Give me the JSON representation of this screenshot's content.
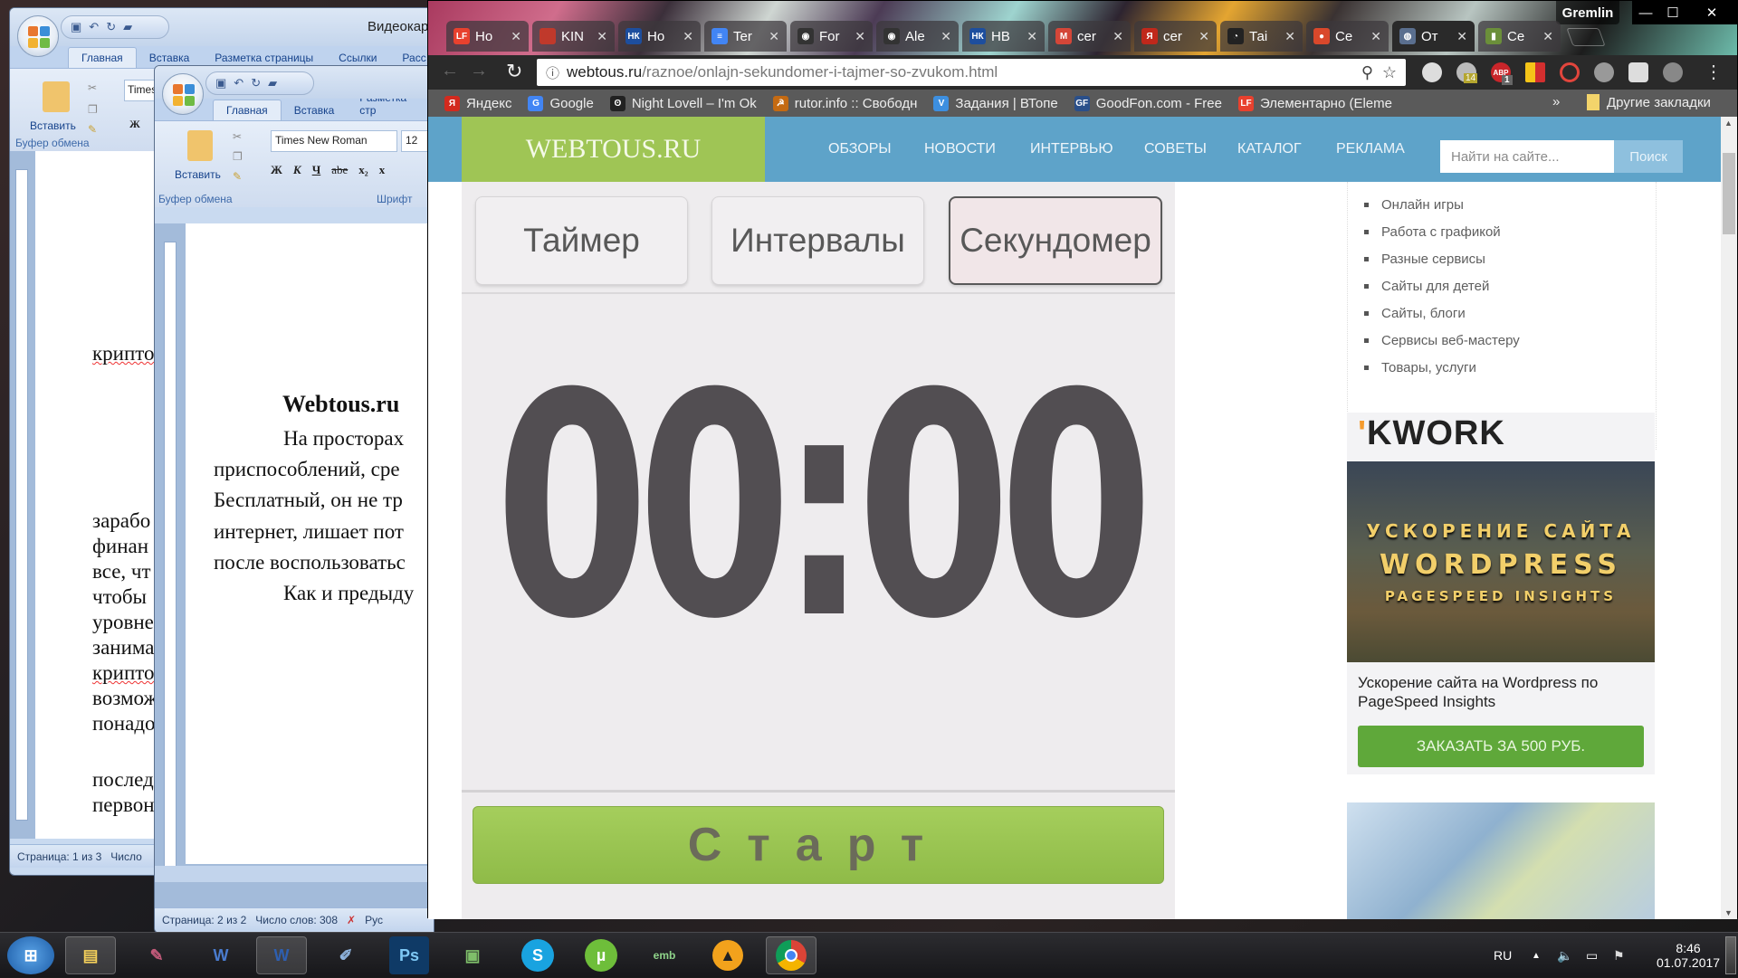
{
  "word_back": {
    "title": "Видеокар",
    "tabs": [
      "Главная",
      "Вставка",
      "Разметка страницы",
      "Ссылки",
      "Расс"
    ],
    "paste_label": "Вставить",
    "clipboard_group": "Буфер обмена",
    "font_name": "Times",
    "bold_label": "Ж",
    "doc_lines": [
      "крипто",
      "зарабо",
      "финан",
      "все, чт",
      "чтобы",
      "уровне",
      "занима",
      "крипто",
      "возмож",
      "понадо",
      "послед",
      "первон"
    ],
    "status": {
      "page": "Страница: 1 из 3",
      "words": "Число"
    }
  },
  "word_front": {
    "tabs": [
      "Главная",
      "Вставка",
      "Разметка стр"
    ],
    "paste_label": "Вставить",
    "clipboard_group": "Буфер обмена",
    "font_group": "Шрифт",
    "font_name": "Times New Roman",
    "font_size": "12",
    "format_buttons": [
      "Ж",
      "К",
      "Ч",
      "abe",
      "x₂",
      "x"
    ],
    "doc_heading": "Webtous.ru",
    "doc_lines": [
      "На просторах",
      "приспособлений, сре",
      "Бесплатный, он не тр",
      "интернет, лишает пот",
      "после воспользоватьс",
      "Как и предыду"
    ],
    "status": {
      "page": "Страница: 2 из 2",
      "words": "Число слов: 308",
      "lang": "Рус"
    }
  },
  "chrome": {
    "profile": "Gremlin",
    "tabs": [
      {
        "icon": "LF",
        "title": "Но",
        "color": "#e8412e"
      },
      {
        "icon": "",
        "title": "KIN",
        "color": "#c0392b"
      },
      {
        "icon": "НК",
        "title": "Но",
        "color": "#1d4e9e"
      },
      {
        "icon": "≡",
        "title": "Ter",
        "color": "#4285f4"
      },
      {
        "icon": "◉",
        "title": "For",
        "color": "#333"
      },
      {
        "icon": "◉",
        "title": "Ale",
        "color": "#333"
      },
      {
        "icon": "НК",
        "title": "НВ",
        "color": "#1d4e9e"
      },
      {
        "icon": "M",
        "title": "cer",
        "color": "#d44638"
      },
      {
        "icon": "Я",
        "title": "cer",
        "color": "#c0281b"
      },
      {
        "icon": "◔",
        "title": "Таі",
        "color": "#222"
      },
      {
        "icon": "●",
        "title": "Се",
        "color": "#d9482b"
      },
      {
        "icon": "◍",
        "title": "От",
        "color": "#5a6f8f"
      },
      {
        "icon": "▮",
        "title": "Се",
        "color": "#6b8f3a"
      }
    ],
    "active_tab_index": 11,
    "url_host": "webtous.ru",
    "url_path": "/raznoe/onlajn-sekundomer-i-tajmer-so-zvukom.html",
    "extension_badges": {
      "adblock": "1",
      "counter": "14"
    },
    "bookmarks": [
      {
        "icon": "Я",
        "label": "Яндекс",
        "color": "#d32a1e"
      },
      {
        "icon": "G",
        "label": "Google",
        "color": "#4285f4"
      },
      {
        "icon": "ʘ",
        "label": "Night Lovell – I'm Ok",
        "color": "#222"
      },
      {
        "icon": "☭",
        "label": "rutor.info :: Свободн",
        "color": "#c46a12"
      },
      {
        "icon": "V",
        "label": "Задания | ВТопе",
        "color": "#3d8fe0"
      },
      {
        "icon": "GF",
        "label": "GoodFon.com - Free",
        "color": "#2a4f8a"
      },
      {
        "icon": "LF",
        "label": "Элементарно (Eleme",
        "color": "#e8412e"
      }
    ],
    "bookmarks_overflow": "»",
    "other_bookmarks": "Другие закладки"
  },
  "site": {
    "logo": "WEBTOUS.RU",
    "nav": [
      "ОБЗОРЫ",
      "НОВОСТИ",
      "ИНТЕРВЬЮ",
      "СОВЕТЫ",
      "КАТАЛОГ",
      "РЕКЛАМА"
    ],
    "search_placeholder": "Найти на сайте...",
    "search_button": "Поиск",
    "modes": [
      "Таймер",
      "Интервалы",
      "Секундомер"
    ],
    "active_mode": "Секундомер",
    "clock": "00:00",
    "start_button": "Старт",
    "sidebar_categories": [
      "Онлайн игры",
      "Работа с графикой",
      "Разные сервисы",
      "Сайты для детей",
      "Сайты, блоги",
      "Сервисы веб-мастеру",
      "Товары, услуги"
    ],
    "ad": {
      "brand": "KWORK",
      "banner_lines": [
        "УСКОРЕНИЕ САЙТА",
        "WORDPRESS",
        "PAGESPEED INSIGHTS"
      ],
      "title": "Ускорение сайта на Wordpress по PageSpeed Insights",
      "button": "ЗАКАЗАТЬ ЗА 500 РУБ."
    }
  },
  "taskbar": {
    "apps": [
      "start",
      "explorer",
      "access",
      "word",
      "word-active",
      "paint",
      "photoshop",
      "network",
      "skype",
      "utorrent",
      "emb",
      "aimp",
      "chrome"
    ],
    "lang": "RU",
    "time": "8:46",
    "date": "01.07.2017"
  }
}
